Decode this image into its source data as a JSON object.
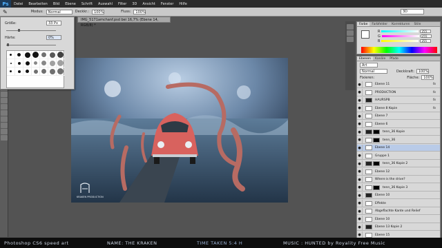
{
  "menu": {
    "logo": "Ps",
    "items": [
      "Datei",
      "Bearbeiten",
      "Bild",
      "Ebene",
      "Schrift",
      "Auswahl",
      "Filter",
      "3D",
      "Ansicht",
      "Fenster",
      "Hilfe"
    ]
  },
  "options": {
    "mode_label": "Modus:",
    "mode_value": "Normal",
    "opacity_label": "Deckkr.:",
    "opacity_value": "100%",
    "flow_label": "Fluss:",
    "flow_value": "100%",
    "workspace": "3D"
  },
  "document": {
    "tab": "IMG_5171amchanf.psd bei 16,7% (Ebene 14, RGB/8) *"
  },
  "brush_panel": {
    "size_label": "Größe:",
    "size_value": "33 Px",
    "hardness_label": "Härte:",
    "hardness_value": "0%"
  },
  "color_panel": {
    "tabs": [
      "Farbe",
      "Farbfelder",
      "Korrekturen",
      "Stile"
    ],
    "r": "255",
    "g": "255",
    "b": "255",
    "r_label": "R",
    "g_label": "G",
    "b_label": "B"
  },
  "layers_panel": {
    "tabs": [
      "Ebenen",
      "Kanäle",
      "Pfade"
    ],
    "kind": "Art",
    "blend_mode": "Normal",
    "opacity_label": "Deckkraft:",
    "opacity_value": "100%",
    "lock_label": "Fixieren:",
    "fill_label": "Fläche:",
    "fill_value": "100%",
    "layers": [
      {
        "name": "Ebene 11",
        "fx": true
      },
      {
        "name": "PRODUCTION",
        "fx": true
      },
      {
        "name": "HAURSPB",
        "fx": true
      },
      {
        "name": "Ebene 8 Kopie",
        "fx": true
      },
      {
        "name": "Ebene 7",
        "fx": false
      },
      {
        "name": "Ebene 6",
        "fx": false
      },
      {
        "name": "tenn_36 Kopie",
        "fx": false
      },
      {
        "name": "tenn_36",
        "fx": false
      },
      {
        "name": "Ebene 14",
        "fx": false,
        "selected": true
      },
      {
        "name": "Gruppe 1",
        "fx": false
      },
      {
        "name": "tenn_36 Kopie 2",
        "fx": false
      },
      {
        "name": "Ebene 12",
        "fx": false
      },
      {
        "name": "Where is the drive?",
        "fx": false
      },
      {
        "name": "tenn_36 Kopie 3",
        "fx": false
      },
      {
        "name": "Ebene 10",
        "fx": false
      },
      {
        "name": "Effekte",
        "fx": false
      },
      {
        "name": "Abgeflachte Kante und Relief",
        "fx": false
      },
      {
        "name": "Ebene 10",
        "fx": false
      },
      {
        "name": "Ebene 13 Kopie 2",
        "fx": false
      },
      {
        "name": "Ebene 15",
        "fx": false
      }
    ]
  },
  "canvas": {
    "watermark": "KRAKEN PRODUCTION"
  },
  "status": {
    "left": "Photoshop CS6 speed art",
    "name": "NAME: THE KRAKEN",
    "time": "TIME TAKEN 5:4 H",
    "music": "MUSIC : HUNTED by Royality Free Music"
  },
  "colors": {
    "accent": "#b9cbe8",
    "background": "#535353",
    "car": "#d8625e"
  }
}
